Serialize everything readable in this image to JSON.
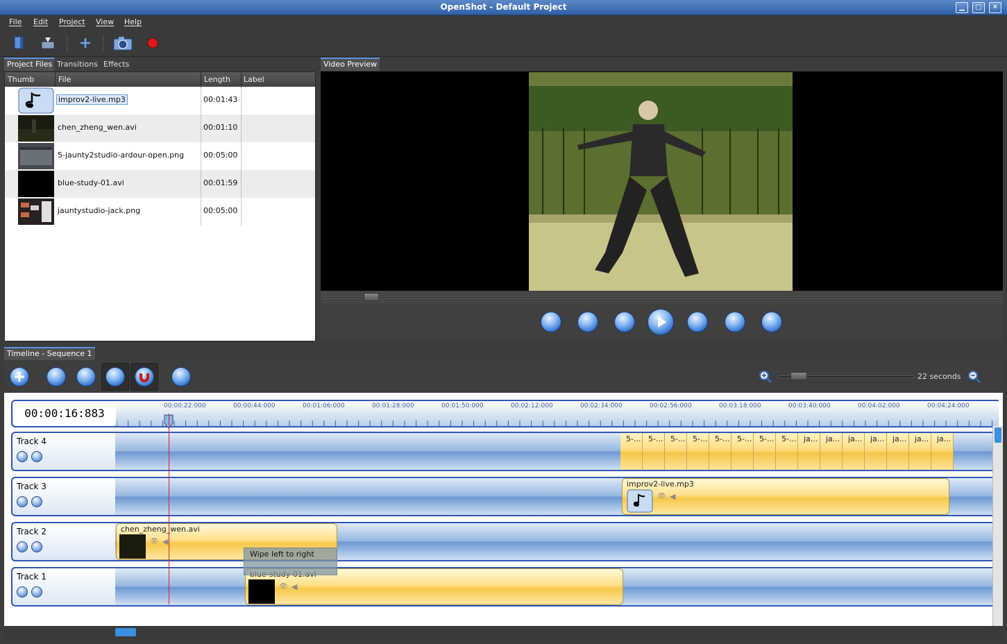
{
  "window": {
    "title": "OpenShot - Default Project"
  },
  "menu": [
    "File",
    "Edit",
    "Project",
    "View",
    "Help"
  ],
  "toolbar": [
    "new-project-icon",
    "import-icon",
    "add-icon",
    "snapshot-icon",
    "record-icon"
  ],
  "left_tabs": [
    "Project Files",
    "Transitions",
    "Effects"
  ],
  "files": {
    "headers": {
      "thumb": "Thumb",
      "file": "File",
      "length": "Length",
      "label": "Label"
    },
    "rows": [
      {
        "name": "improv2-live.mp3",
        "length": "00:01:43",
        "thumb": "music-note-icon"
      },
      {
        "name": "chen_zheng_wen.avi",
        "length": "00:01:10",
        "thumb": "video-dark-thumb"
      },
      {
        "name": "5-jaunty2studio-ardour-open.png",
        "length": "00:05:00",
        "thumb": "ardour-thumb"
      },
      {
        "name": "blue-study-01.avi",
        "length": "00:01:59",
        "thumb": "black-thumb"
      },
      {
        "name": "jauntystudio-jack.png",
        "length": "00:05:00",
        "thumb": "jack-thumb"
      }
    ]
  },
  "preview": {
    "tab": "Video Preview"
  },
  "playback_buttons": [
    "jump-start-icon",
    "prev-marker-icon",
    "rewind-icon",
    "play-icon",
    "fast-forward-icon",
    "next-marker-icon",
    "jump-end-icon"
  ],
  "timeline": {
    "tab": "Timeline - Sequence 1",
    "zoom_label": "22 seconds",
    "timecode": "00:00:16:883",
    "ticks": [
      "00:00:22:000",
      "00:00:44:000",
      "00:01:06:000",
      "00:01:28:000",
      "00:01:50:000",
      "00:02:12:000",
      "00:02:34:000",
      "00:02:56:000",
      "00:03:18:000",
      "00:03:40:000",
      "00:04:02:000",
      "00:04:24:000"
    ],
    "tracks": [
      "Track 4",
      "Track 3",
      "Track 2",
      "Track 1"
    ],
    "track4_minis": [
      "5-...",
      "5-...",
      "5-...",
      "5-...",
      "5-...",
      "5-...",
      "5-...",
      "5-...",
      "ja...",
      "ja...",
      "ja...",
      "ja...",
      "ja...",
      "ja...",
      "ja..."
    ],
    "clips": {
      "track3": "improv2-live.mp3",
      "track2": "chen_zheng_wen.avi",
      "track1": "blue-study-01.avi"
    },
    "transition": "Wipe left to right"
  },
  "colors": {
    "accent": "#2f58b4",
    "clip": "#ffe08a",
    "playhead": "#e02020"
  }
}
